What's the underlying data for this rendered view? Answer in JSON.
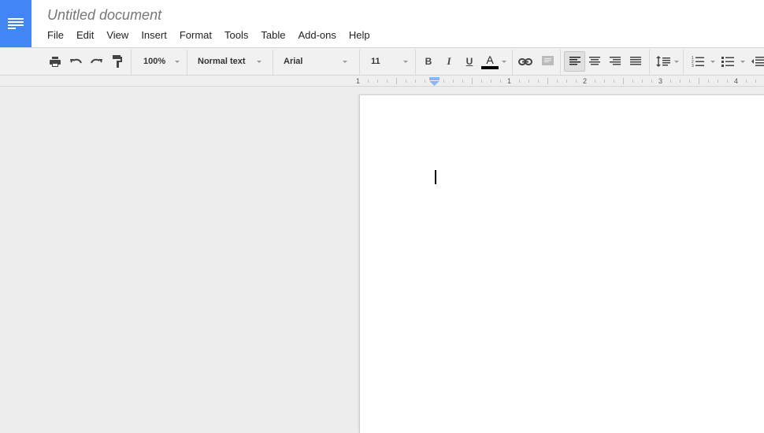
{
  "app": {
    "name": "Google Docs",
    "brand_color": "#4285f4",
    "logo_icon": "docs-lines-icon"
  },
  "document": {
    "title": "Untitled document",
    "body_text": ""
  },
  "menu": {
    "items": [
      {
        "label": "File"
      },
      {
        "label": "Edit"
      },
      {
        "label": "View"
      },
      {
        "label": "Insert"
      },
      {
        "label": "Format"
      },
      {
        "label": "Tools"
      },
      {
        "label": "Table"
      },
      {
        "label": "Add-ons"
      },
      {
        "label": "Help"
      }
    ]
  },
  "toolbar": {
    "print_icon": "print-icon",
    "undo_icon": "undo-icon",
    "redo_icon": "redo-icon",
    "paint_format_icon": "paint-roller-icon",
    "zoom": "100%",
    "style": "Normal text",
    "font": "Arial",
    "font_size": "11",
    "bold_label": "B",
    "italic_label": "I",
    "underline_label": "U",
    "text_color_label": "A",
    "text_color": "#000000",
    "link_icon": "link-icon",
    "comment_icon": "comment-icon",
    "align": {
      "active": "left",
      "options": [
        "left",
        "center",
        "right",
        "justify"
      ]
    },
    "line_spacing_icon": "line-spacing-icon",
    "numbered_list_icon": "numbered-list-icon",
    "bulleted_list_icon": "bulleted-list-icon",
    "decrease_indent_icon": "decrease-indent-icon"
  },
  "ruler": {
    "labels": [
      "1",
      "1",
      "2",
      "3",
      "4"
    ],
    "units": "inches"
  }
}
